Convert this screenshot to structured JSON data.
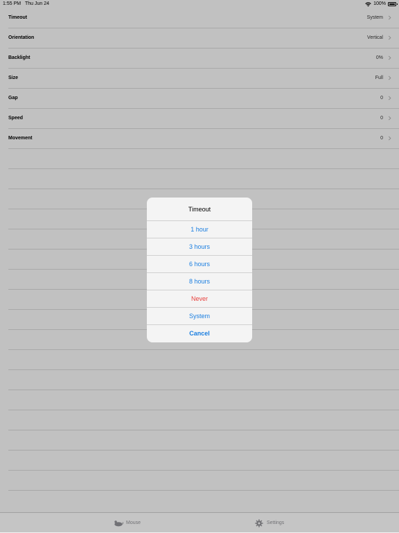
{
  "status_bar": {
    "time": "1:55 PM",
    "date": "Thu Jun 24",
    "battery": "100%"
  },
  "settings": {
    "rows": [
      {
        "label": "Timeout",
        "value": "System"
      },
      {
        "label": "Orientation",
        "value": "Vertical"
      },
      {
        "label": "Backlight",
        "value": "0%"
      },
      {
        "label": "Size",
        "value": "Full"
      },
      {
        "label": "Gap",
        "value": "0"
      },
      {
        "label": "Speed",
        "value": "0"
      },
      {
        "label": "Movement",
        "value": "0"
      }
    ]
  },
  "alert": {
    "title": "Timeout",
    "options": [
      {
        "label": "1 hour"
      },
      {
        "label": "3 hours"
      },
      {
        "label": "6 hours"
      },
      {
        "label": "8 hours"
      },
      {
        "label": "Never"
      },
      {
        "label": "System"
      }
    ],
    "cancel_label": "Cancel"
  },
  "tab_bar": {
    "tabs": [
      {
        "label": "Mouse",
        "icon": "mouse-icon"
      },
      {
        "label": "Settings",
        "icon": "gear-icon"
      }
    ]
  },
  "colors": {
    "accent": "#1a7ee0",
    "destructive": "#e8403c",
    "tab_inactive": "#8e8e93"
  }
}
